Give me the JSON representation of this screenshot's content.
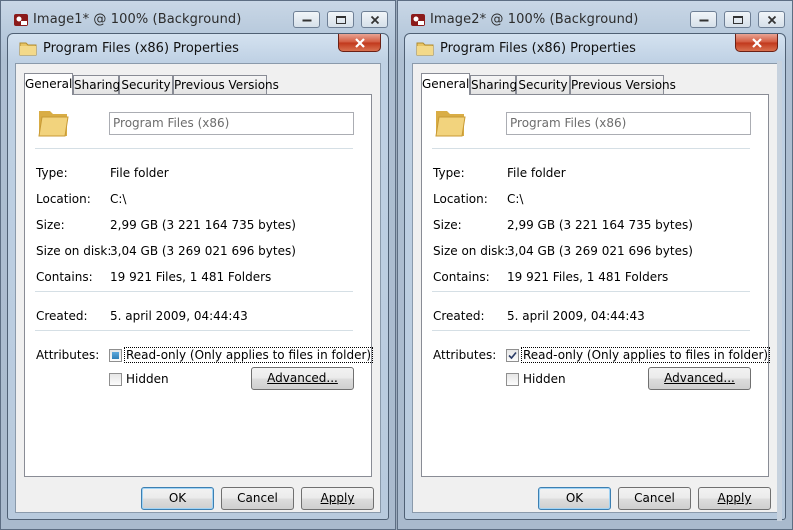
{
  "windows": [
    {
      "outer_title": "Image1* @ 100% (Background)",
      "dialog_title": "Program Files (x86) Properties",
      "tabs": [
        "General",
        "Sharing",
        "Security",
        "Previous Versions"
      ],
      "folder_name": "Program Files (x86)",
      "props": {
        "type_label": "Type:",
        "type_value": "File folder",
        "location_label": "Location:",
        "location_value": "C:\\",
        "size_label": "Size:",
        "size_value": "2,99 GB (3 221 164 735 bytes)",
        "size_on_disk_label": "Size on disk:",
        "size_on_disk_value": "3,04 GB (3 269 021 696 bytes)",
        "contains_label": "Contains:",
        "contains_value": "19 921 Files, 1 481 Folders",
        "created_label": "Created:",
        "created_value": "5. april 2009, 04:44:43",
        "attributes_label": "Attributes:"
      },
      "readonly_label": "Read-only (Only applies to files in folder)",
      "readonly_state": "indeterminate",
      "hidden_label": "Hidden",
      "advanced_label": "Advanced...",
      "ok_label": "OK",
      "cancel_label": "Cancel",
      "apply_label": "Apply"
    },
    {
      "outer_title": "Image2* @ 100% (Background)",
      "dialog_title": "Program Files (x86) Properties",
      "tabs": [
        "General",
        "Sharing",
        "Security",
        "Previous Versions"
      ],
      "folder_name": "Program Files (x86)",
      "props": {
        "type_label": "Type:",
        "type_value": "File folder",
        "location_label": "Location:",
        "location_value": "C:\\",
        "size_label": "Size:",
        "size_value": "2,99 GB (3 221 164 735 bytes)",
        "size_on_disk_label": "Size on disk:",
        "size_on_disk_value": "3,04 GB (3 269 021 696 bytes)",
        "contains_label": "Contains:",
        "contains_value": "19 921 Files, 1 481 Folders",
        "created_label": "Created:",
        "created_value": "5. april 2009, 04:44:43",
        "attributes_label": "Attributes:"
      },
      "readonly_label": "Read-only (Only applies to files in folder)",
      "readonly_state": "checked",
      "hidden_label": "Hidden",
      "advanced_label": "Advanced...",
      "ok_label": "OK",
      "cancel_label": "Cancel",
      "apply_label": "Apply"
    }
  ],
  "icons": {
    "app_icon": "image-app-icon",
    "folder_icon": "folder-icon",
    "minimize": "minimize-icon",
    "maximize": "maximize-icon",
    "close": "close-icon"
  },
  "colors": {
    "close_button": "#c94a2d",
    "checkbox_indeterminate": "#2f7fb7",
    "folder": "#e8c565"
  }
}
